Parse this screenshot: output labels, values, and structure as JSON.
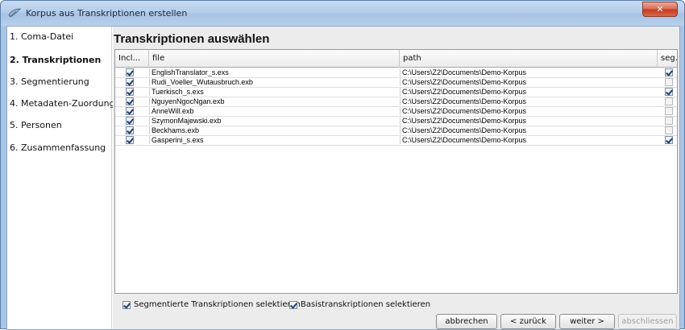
{
  "window": {
    "title": "Korpus aus Transkriptionen erstellen",
    "close_glyph": "✕"
  },
  "sidebar": {
    "items": [
      {
        "label": "1. Coma-Datei",
        "active": false
      },
      {
        "label": "2. Transkriptionen",
        "active": true
      },
      {
        "label": "3. Segmentierung",
        "active": false
      },
      {
        "label": "4. Metadaten-Zuordung",
        "active": false
      },
      {
        "label": "5. Personen",
        "active": false
      },
      {
        "label": "6. Zusammenfassung",
        "active": false
      }
    ]
  },
  "main": {
    "heading": "Transkriptionen auswählen",
    "table": {
      "columns": [
        "Incl...",
        "file",
        "path",
        "seg..."
      ],
      "rows": [
        {
          "incl": true,
          "file": "EnglishTranslator_s.exs",
          "path": "C:\\Users\\Z2\\Documents\\Demo-Korpus",
          "seg": true
        },
        {
          "incl": true,
          "file": "Rudi_Voeller_Wutausbruch.exb",
          "path": "C:\\Users\\Z2\\Documents\\Demo-Korpus",
          "seg": false
        },
        {
          "incl": true,
          "file": "Tuerkisch_s.exs",
          "path": "C:\\Users\\Z2\\Documents\\Demo-Korpus",
          "seg": true
        },
        {
          "incl": true,
          "file": "NguyenNgocNgan.exb",
          "path": "C:\\Users\\Z2\\Documents\\Demo-Korpus",
          "seg": false
        },
        {
          "incl": true,
          "file": "AnneWill.exb",
          "path": "C:\\Users\\Z2\\Documents\\Demo-Korpus",
          "seg": false
        },
        {
          "incl": true,
          "file": "SzymonMajewski.exb",
          "path": "C:\\Users\\Z2\\Documents\\Demo-Korpus",
          "seg": false
        },
        {
          "incl": true,
          "file": "Beckhams.exb",
          "path": "C:\\Users\\Z2\\Documents\\Demo-Korpus",
          "seg": false
        },
        {
          "incl": true,
          "file": "Gasperini_s.exs",
          "path": "C:\\Users\\Z2\\Documents\\Demo-Korpus",
          "seg": true
        }
      ]
    },
    "select_segmented_label": "Segmentierte Transkriptionen selektieren",
    "select_segmented_checked": true,
    "select_basic_label": "Basistranskriptionen selektieren",
    "select_basic_checked": true
  },
  "buttons": {
    "cancel": "abbrechen",
    "back": "< zurück",
    "next": "weiter >",
    "finish": "abschliessen"
  }
}
